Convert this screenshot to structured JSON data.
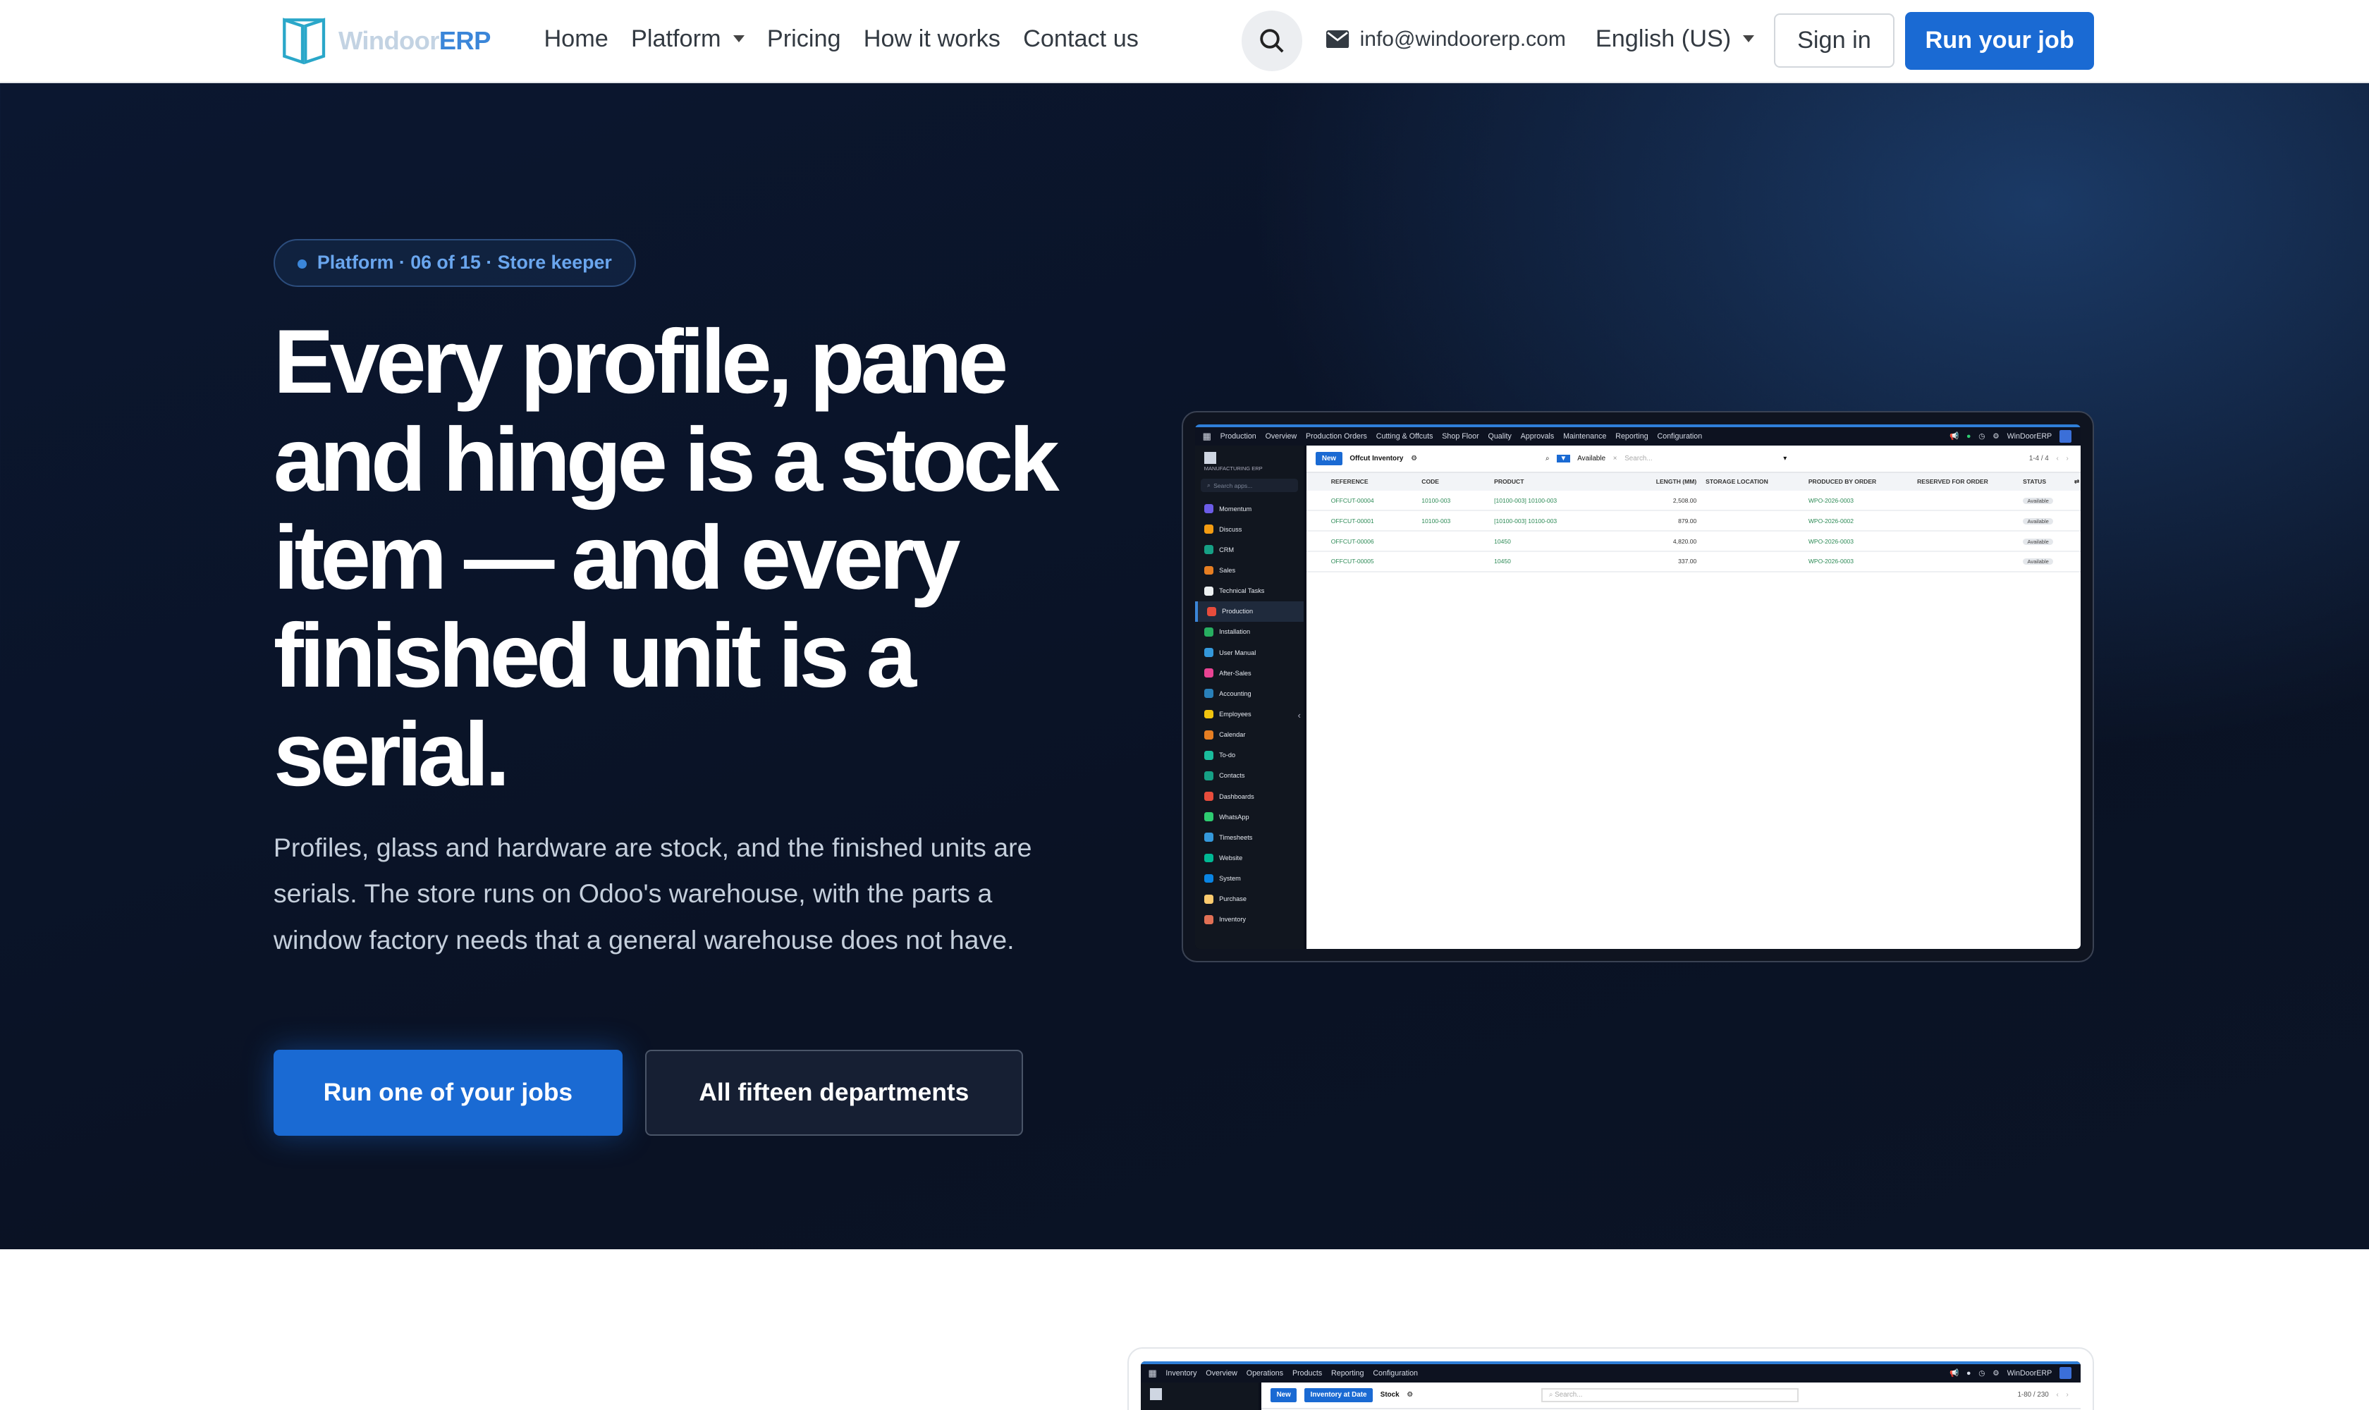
{
  "nav": {
    "logo_part1": "Windoor",
    "logo_part2": "ERP",
    "links": [
      "Home",
      "Platform",
      "Pricing",
      "How it works",
      "Contact us"
    ],
    "email": "info@windoorerp.com",
    "language": "English (US)",
    "signin": "Sign in",
    "cta": "Run your job"
  },
  "hero": {
    "badge": "Platform · 06 of 15 · Store keeper",
    "headline": "Every profile, pane and hinge is a stock item — and every finished unit is a serial.",
    "subtitle": "Profiles, glass and hardware are stock, and the finished units are serials. The store runs on Odoo's warehouse, with the parts a window factory needs that a general warehouse does not have.",
    "primary_button": "Run one of your jobs",
    "secondary_button": "All fifteen departments"
  },
  "app_shot": {
    "topbar": [
      "Production",
      "Overview",
      "Production Orders",
      "Cutting & Offcuts",
      "Shop Floor",
      "Quality",
      "Approvals",
      "Maintenance",
      "Reporting",
      "Configuration"
    ],
    "company": "WinDoorERP",
    "brand": "MANUFACTURING ERP",
    "search_apps": "Search apps...",
    "sidebar": [
      {
        "label": "Momentum",
        "color": "#6c5ce7"
      },
      {
        "label": "Discuss",
        "color": "#f39c12"
      },
      {
        "label": "CRM",
        "color": "#16a085"
      },
      {
        "label": "Sales",
        "color": "#e67e22"
      },
      {
        "label": "Technical Tasks",
        "color": "#ecf0f1"
      },
      {
        "label": "Production",
        "color": "#e74c3c"
      },
      {
        "label": "Installation",
        "color": "#27ae60"
      },
      {
        "label": "User Manual",
        "color": "#3498db"
      },
      {
        "label": "After-Sales",
        "color": "#e84393"
      },
      {
        "label": "Accounting",
        "color": "#2980b9"
      },
      {
        "label": "Employees",
        "color": "#f1c40f"
      },
      {
        "label": "Calendar",
        "color": "#e67e22"
      },
      {
        "label": "To-do",
        "color": "#1abc9c"
      },
      {
        "label": "Contacts",
        "color": "#16a085"
      },
      {
        "label": "Dashboards",
        "color": "#e74c3c"
      },
      {
        "label": "WhatsApp",
        "color": "#2ecc71"
      },
      {
        "label": "Timesheets",
        "color": "#3498db"
      },
      {
        "label": "Website",
        "color": "#00b894"
      },
      {
        "label": "System",
        "color": "#0984e3"
      },
      {
        "label": "Purchase",
        "color": "#fdcb6e"
      },
      {
        "label": "Inventory",
        "color": "#e17055"
      }
    ],
    "view": {
      "new": "New",
      "title": "Offcut Inventory",
      "filter": "Available",
      "search": "Search...",
      "pager": "1-4 / 4"
    },
    "columns": [
      "REFERENCE",
      "CODE",
      "PRODUCT",
      "LENGTH (MM)",
      "STORAGE LOCATION",
      "PRODUCED BY ORDER",
      "RESERVED FOR ORDER",
      "STATUS"
    ],
    "rows": [
      {
        "ref": "OFFCUT-00004",
        "code": "10100-003",
        "product": "[10100-003] 10100-003",
        "length": "2,508.00",
        "location": "",
        "produced": "WPO-2026-0003",
        "reserved": "",
        "status": "Available"
      },
      {
        "ref": "OFFCUT-00001",
        "code": "10100-003",
        "product": "[10100-003] 10100-003",
        "length": "879.00",
        "location": "",
        "produced": "WPO-2026-0002",
        "reserved": "",
        "status": "Available"
      },
      {
        "ref": "OFFCUT-00006",
        "code": "",
        "product": "10450",
        "length": "4,820.00",
        "location": "",
        "produced": "WPO-2026-0003",
        "reserved": "",
        "status": "Available"
      },
      {
        "ref": "OFFCUT-00005",
        "code": "",
        "product": "10450",
        "length": "337.00",
        "location": "",
        "produced": "WPO-2026-0003",
        "reserved": "",
        "status": "Available"
      }
    ]
  },
  "second_shot": {
    "topbar": [
      "Inventory",
      "Overview",
      "Operations",
      "Products",
      "Reporting",
      "Configuration"
    ],
    "company": "WinDoorERP",
    "new": "New",
    "button": "Inventory at Date",
    "title": "Stock",
    "search": "Search...",
    "pager": "1-80 / 230"
  }
}
